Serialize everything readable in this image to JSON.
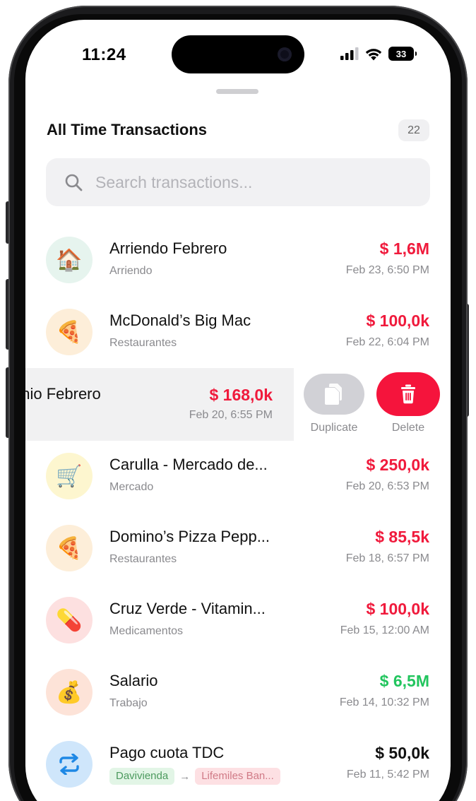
{
  "status_bar": {
    "time": "11:24",
    "battery": "33"
  },
  "sheet": {
    "title": "All Time Transactions",
    "count": "22"
  },
  "search": {
    "placeholder": "Search transactions..."
  },
  "colors": {
    "expense": "#f01a3c",
    "income": "#22c55e",
    "neutral": "#111111",
    "delete": "#f5143c",
    "duplicate": "#d1d1d6"
  },
  "transactions": [
    {
      "title": "Arriendo Febrero",
      "category": "Arriendo",
      "amount": "$ 1,6M",
      "date": "Feb 23, 6:50 PM",
      "icon": "house-icon",
      "emoji": "🏠",
      "bg": "#e6f4ee",
      "type": "expense"
    },
    {
      "title": "McDonald’s Big Mac",
      "category": "Restaurantes",
      "amount": "$ 100,0k",
      "date": "Feb 22, 6:04 PM",
      "icon": "pizza-icon",
      "emoji": "🍕",
      "bg": "#fdeed9",
      "type": "expense"
    },
    {
      "title": "Carulla - Mercado de...",
      "category": "Mercado",
      "amount": "$ 250,0k",
      "date": "Feb 20, 6:53 PM",
      "icon": "shopping-cart-icon",
      "emoji": "🛒",
      "bg": "#fdf6cf",
      "type": "expense"
    },
    {
      "title": "Domino’s Pizza Pepp...",
      "category": "Restaurantes",
      "amount": "$ 85,5k",
      "date": "Feb 18, 6:57 PM",
      "icon": "pizza-icon",
      "emoji": "🍕",
      "bg": "#fdeed9",
      "type": "expense"
    },
    {
      "title": "Cruz Verde - Vitamin...",
      "category": "Medicamentos",
      "amount": "$ 100,0k",
      "date": "Feb 15, 12:00 AM",
      "icon": "pill-icon",
      "emoji": "💊",
      "bg": "#fde0e0",
      "type": "expense"
    },
    {
      "title": "Salario",
      "category": "Trabajo",
      "amount": "$ 6,5M",
      "date": "Feb 14, 10:32 PM",
      "icon": "money-bag-icon",
      "emoji": "💰",
      "bg": "#fde3d8",
      "type": "income"
    }
  ],
  "swiped_row": {
    "title": "enio Febrero",
    "amount": "$ 168,0k",
    "date": "Feb 20, 6:55 PM",
    "duplicate_label": "Duplicate",
    "delete_label": "Delete"
  },
  "transfer_row": {
    "title": "Pago cuota TDC",
    "from_account": "Davivienda",
    "arrow": "→",
    "to_account": "Lifemiles Ban...",
    "amount": "$ 50,0k",
    "date": "Feb 11, 5:42 PM",
    "icon": "transfer-icon"
  }
}
